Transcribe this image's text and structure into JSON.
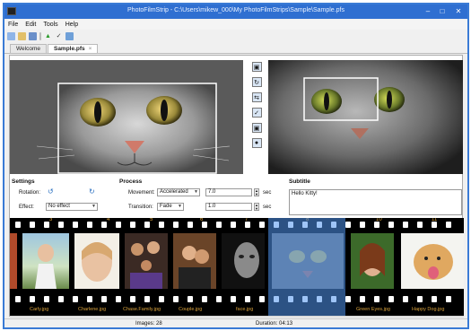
{
  "window": {
    "title": "PhotoFilmStrip - C:\\Users\\mikew_000\\My PhotoFilmStrips\\Sample\\Sample.pfs",
    "minimize": "–",
    "maximize": "□",
    "close": "✕"
  },
  "menu": {
    "items": [
      "File",
      "Edit",
      "Tools",
      "Help"
    ]
  },
  "tabs": {
    "welcome": "Welcome",
    "sample": "Sample.pfs",
    "close": "×"
  },
  "settings": {
    "heading": "Settings",
    "rotation_label": "Rotation:",
    "effect_label": "Effect:",
    "effect_value": "No effect"
  },
  "process": {
    "heading": "Process",
    "movement_label": "Movement:",
    "movement_value": "Accelerated",
    "movement_seconds": "7.0",
    "transition_label": "Transition:",
    "transition_value": "Fade",
    "transition_seconds": "1.0",
    "sec_unit": "sec"
  },
  "subtitle": {
    "heading": "Subtitle",
    "text": "Hello Kitty!"
  },
  "filmstrip": {
    "frames": [
      {
        "number": "3",
        "name": "Carly.jpg"
      },
      {
        "number": "4",
        "name": "Charlene.jpg"
      },
      {
        "number": "5",
        "name": "Chase.Family.jpg"
      },
      {
        "number": "6",
        "name": "Couple.jpg"
      },
      {
        "number": "7",
        "name": "face.jpg"
      },
      {
        "number": "8",
        "name": ""
      },
      {
        "number": "10",
        "name": "Green Eyes.jpg"
      },
      {
        "number": "11",
        "name": "Happy Dog.jpg"
      }
    ]
  },
  "status": {
    "images": "Images: 28",
    "duration": "Duration: 04:13"
  },
  "colors": {
    "titlebar": "#2f6fd1",
    "selection": "#5096f0",
    "filmstrip_text": "#d8a13c"
  }
}
